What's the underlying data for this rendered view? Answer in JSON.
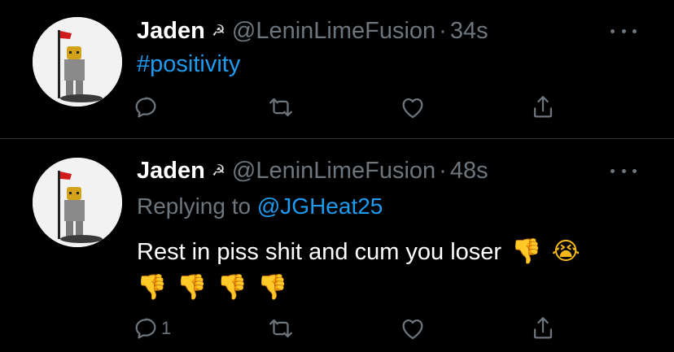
{
  "tweets": [
    {
      "name": "Jaden",
      "name_emoji": "☭",
      "handle": "@LeninLimeFusion",
      "sep": "·",
      "time": "34s",
      "hashtag": "#positivity",
      "reply_count": ""
    },
    {
      "name": "Jaden",
      "name_emoji": "☭",
      "handle": "@LeninLimeFusion",
      "sep": "·",
      "time": "48s",
      "replying_prefix": "Replying to",
      "replying_to": "@JGHeat25",
      "text": "Rest in piss shit and cum you loser",
      "emoji_line1": [
        "👎",
        "😭"
      ],
      "emoji_line2": [
        "👎",
        "👎",
        "👎",
        "👎"
      ],
      "reply_count": "1"
    }
  ],
  "icons": {
    "reply": "reply-icon",
    "retweet": "retweet-icon",
    "like": "like-icon",
    "share": "share-icon",
    "more": "more-icon"
  },
  "colors": {
    "background": "#000000",
    "text": "#ffffff",
    "muted": "#6e767d",
    "link": "#1d9bf0",
    "divider": "#2f3336"
  }
}
